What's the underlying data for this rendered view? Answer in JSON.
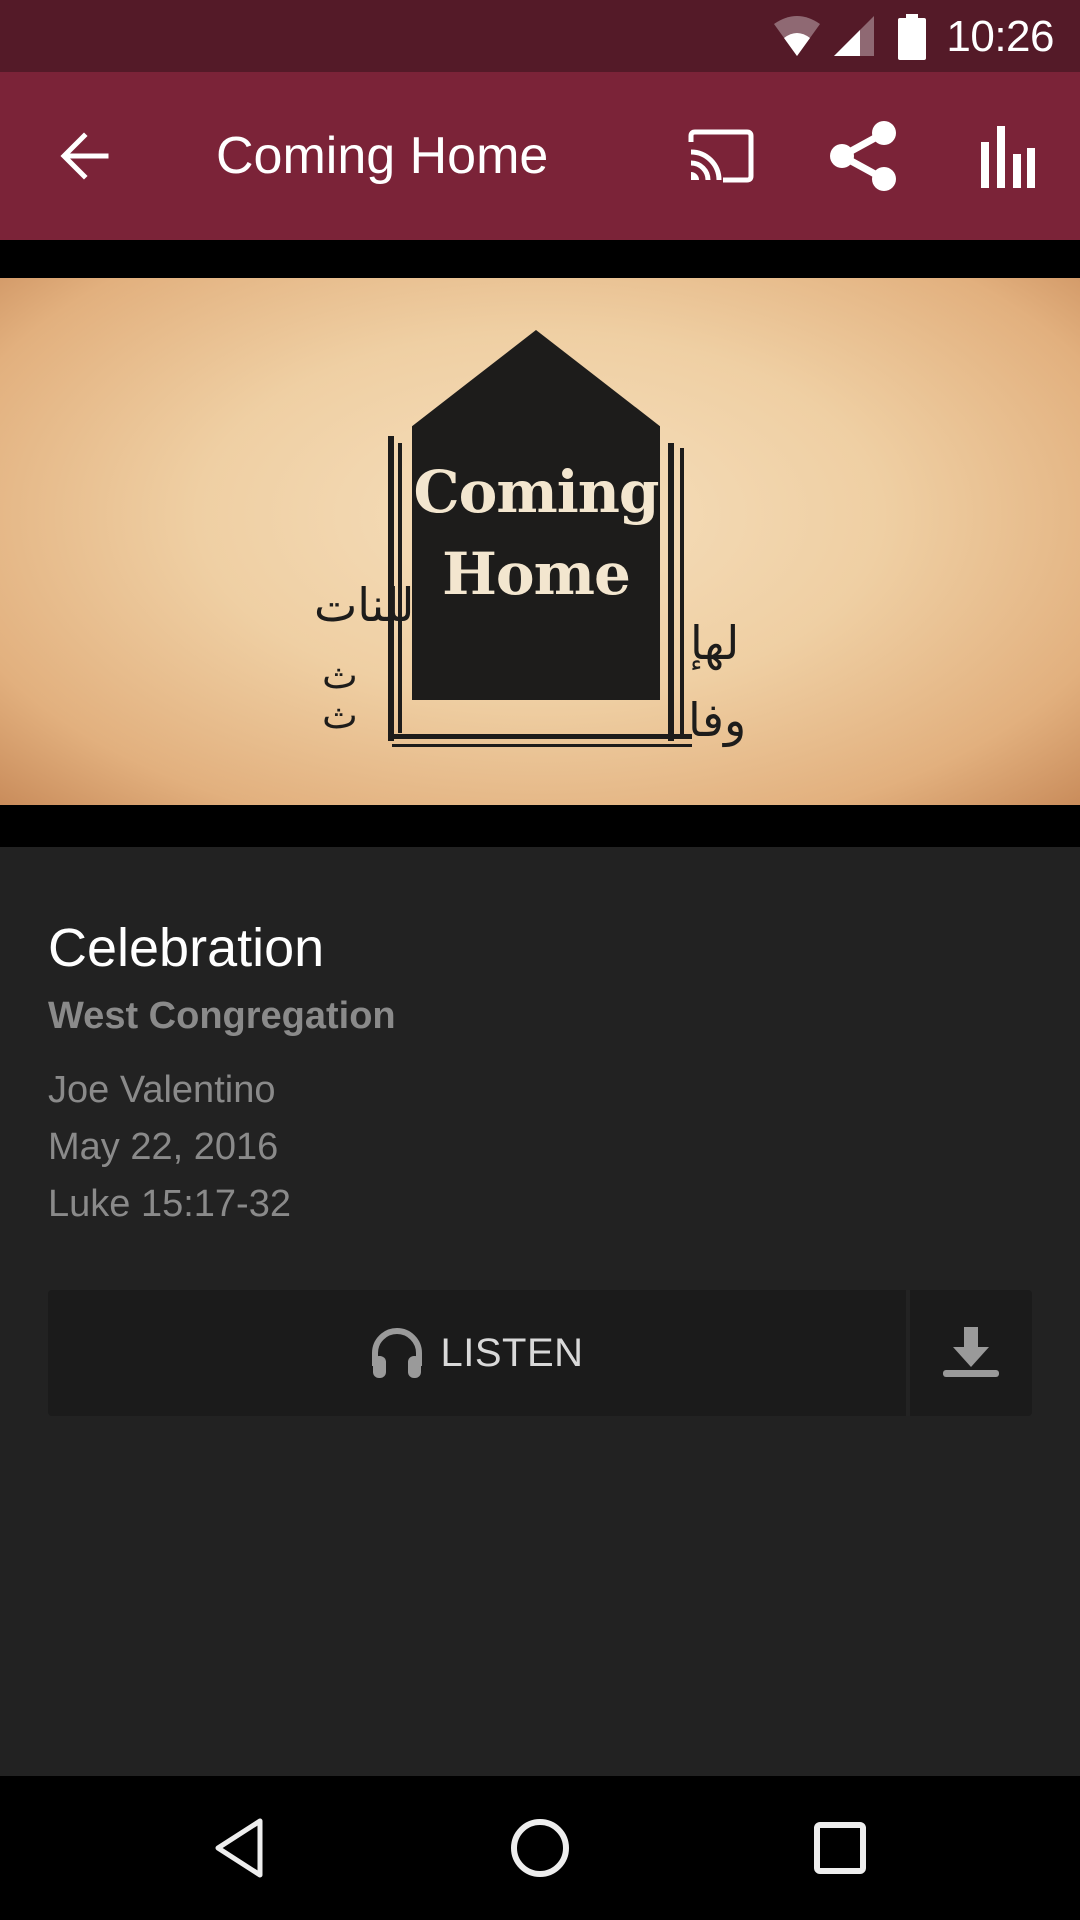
{
  "status_bar": {
    "time": "10:26",
    "icons": [
      "wifi-icon",
      "cell-signal-icon",
      "battery-icon"
    ]
  },
  "app_bar": {
    "title": "Coming Home",
    "actions": [
      {
        "name": "back",
        "icon": "arrow-back-icon"
      },
      {
        "name": "cast",
        "icon": "cast-icon"
      },
      {
        "name": "share",
        "icon": "share-icon"
      },
      {
        "name": "stats",
        "icon": "bar-chart-icon"
      }
    ],
    "colors": {
      "status_bar": "#541a28",
      "app_bar": "#7b2338"
    }
  },
  "artwork": {
    "line1": "Coming",
    "line2": "Home",
    "arabic_left": "للنات",
    "arabic_left_small": "ث",
    "arabic_right": "لهإ",
    "arabic_bottom": "وفا"
  },
  "sermon": {
    "series": "Celebration",
    "congregation": "West Congregation",
    "speaker": "Joe Valentino",
    "date": "May 22, 2016",
    "scripture": "Luke 15:17-32"
  },
  "actions": {
    "listen_label": "LISTEN",
    "listen_icon": "headphones-icon",
    "download_icon": "download-icon"
  },
  "nav_bar": {
    "buttons": [
      "back-triangle-icon",
      "home-circle-icon",
      "recents-square-icon"
    ]
  }
}
